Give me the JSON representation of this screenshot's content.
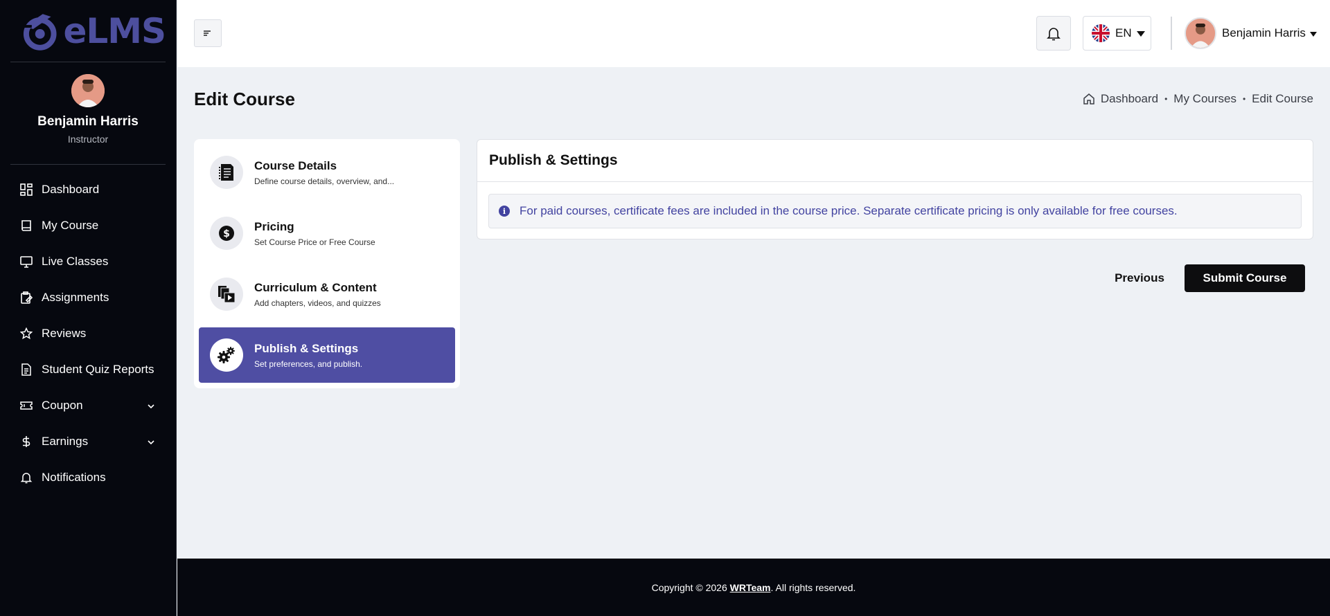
{
  "brand": {
    "name": "eLMS",
    "color": "#4d4f9e"
  },
  "sidebar": {
    "profile": {
      "name": "Benjamin Harris",
      "role": "Instructor"
    },
    "items": [
      {
        "label": "Dashboard",
        "icon": "dashboard-icon"
      },
      {
        "label": "My Course",
        "icon": "book-icon"
      },
      {
        "label": "Live Classes",
        "icon": "monitor-icon"
      },
      {
        "label": "Assignments",
        "icon": "assignment-icon"
      },
      {
        "label": "Reviews",
        "icon": "star-icon"
      },
      {
        "label": "Student Quiz Reports",
        "icon": "report-icon"
      },
      {
        "label": "Coupon",
        "icon": "ticket-icon",
        "expandable": true
      },
      {
        "label": "Earnings",
        "icon": "dollar-icon",
        "expandable": true
      },
      {
        "label": "Notifications",
        "icon": "bell-icon"
      }
    ]
  },
  "header": {
    "language": "EN",
    "user_name": "Benjamin Harris"
  },
  "page": {
    "title": "Edit Course",
    "breadcrumb": [
      "Dashboard",
      "My Courses",
      "Edit Course"
    ]
  },
  "steps": [
    {
      "title": "Course Details",
      "subtitle": "Define course details, overview, and...",
      "icon": "document-icon",
      "active": false
    },
    {
      "title": "Pricing",
      "subtitle": "Set Course Price or Free Course",
      "icon": "dollar-coin-icon",
      "active": false
    },
    {
      "title": "Curriculum & Content",
      "subtitle": "Add chapters, videos, and quizzes",
      "icon": "video-files-icon",
      "active": false
    },
    {
      "title": "Publish & Settings",
      "subtitle": "Set preferences, and publish.",
      "icon": "gears-icon",
      "active": true
    }
  ],
  "publish": {
    "heading": "Publish & Settings",
    "info": "For paid courses, certificate fees are included in the course price. Separate certificate pricing is only available for free courses."
  },
  "actions": {
    "previous": "Previous",
    "submit": "Submit Course"
  },
  "footer": {
    "prefix": "Copyright © 2026 ",
    "link": "WRTeam",
    "suffix": ". All rights reserved."
  },
  "colors": {
    "sidebar_bg": "#06080f",
    "accent": "#4f4ea3",
    "info_text": "#4243a0"
  }
}
